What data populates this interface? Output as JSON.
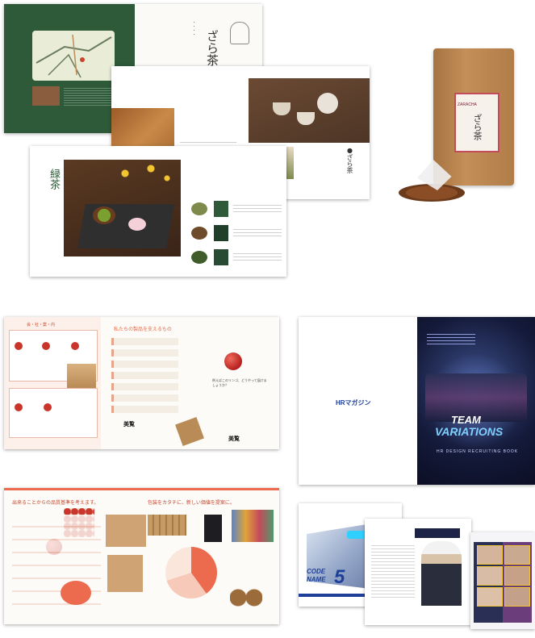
{
  "tea": {
    "title_zara": "ざら茶",
    "title_ryokucha": "緑茶",
    "label_zara": "●ざら茶",
    "pouch_label_top": "ZARACHA",
    "pouch_label_main": "ざら茶"
  },
  "apple": {
    "header_left": "会・社・案・内",
    "header_right": "私たちの製品を支えるもの",
    "brand": "美覧",
    "caption": "例えばこのリンゴ、どうやって届けましょうか？",
    "spread2_left": "出来ることからの品質基準を考えます。",
    "spread2_right": "包装をカタチに、新しい価値を提案に。"
  },
  "hr": {
    "logo": "HRマガジン",
    "team_line1": "TEAM",
    "team_line2": "VARIATIONS",
    "subtitle": "HR DESIGN RECRUITING BOOK",
    "code_line1": "CODE",
    "code_line2": "NAME",
    "code_num": "5"
  },
  "colors": {
    "green": "#2e5a3a",
    "coral": "#ec6a4d",
    "navy": "#1c2347",
    "kraft": "#b7844d"
  }
}
